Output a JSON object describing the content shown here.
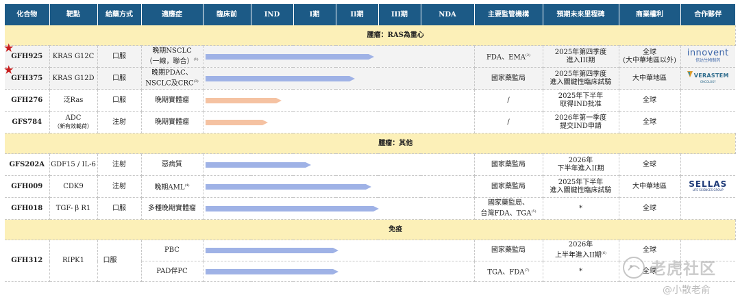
{
  "headers": {
    "compound": "化合物",
    "target": "靶點",
    "route": "給藥方式",
    "indication": "適應症",
    "preclinical": "臨床前",
    "ind": "IND",
    "phase1": "I期",
    "phase2": "II期",
    "phase3": "III期",
    "nda": "NDA",
    "regulator": "主要監管機構",
    "milestone": "預期未來里程碑",
    "rights": "商業權利",
    "partner": "合作夥伴"
  },
  "sections": [
    {
      "title": "腫瘤：RAS為重心"
    },
    {
      "title": "腫瘤：其他"
    },
    {
      "title": "免疫"
    }
  ],
  "rows": [
    {
      "compound": "GFH925",
      "starred": true,
      "target": "KRAS G12C",
      "route": "口服",
      "indication_l1": "晚期NSCLC",
      "indication_l2": "（一線，聯合）",
      "indication_note": "(1)",
      "progress": 0.62,
      "bar_color": "blue",
      "regulator": "FDA、EMA",
      "regulator_note": "(2)",
      "milestone_l1": "2025年第四季度",
      "milestone_l2": "進入III期",
      "rights_l1": "全球",
      "rights_l2": "(大中華地區以外)",
      "partner": "innovent"
    },
    {
      "compound": "GFH375",
      "starred": true,
      "target": "KRAS G12D",
      "route": "口服",
      "indication_l1": "晚期PDAC、",
      "indication_l2": "NSCLC及CRC",
      "indication_note": "(3)",
      "progress": 0.55,
      "bar_color": "blue",
      "regulator": "國家藥監局",
      "regulator_note": "",
      "milestone_l1": "2025年第四季度",
      "milestone_l2": "進入關鍵性臨床試驗",
      "rights_l1": "大中華地區",
      "rights_l2": "",
      "partner": "verastem"
    },
    {
      "compound": "GFH276",
      "starred": false,
      "target": "泛Ras",
      "route": "口服",
      "indication_l1": "晚期實體瘤",
      "indication_l2": "",
      "indication_note": "",
      "progress": 0.28,
      "bar_color": "orange",
      "regulator": "/",
      "regulator_note": "",
      "milestone_l1": "2025年下半年",
      "milestone_l2": "取得IND批准",
      "rights_l1": "全球",
      "rights_l2": "",
      "partner": ""
    },
    {
      "compound": "GFS784",
      "starred": false,
      "target": "ADC",
      "target_l2": "（新有效載荷）",
      "route": "注射",
      "indication_l1": "晚期實體瘤",
      "indication_l2": "",
      "indication_note": "",
      "progress": 0.23,
      "bar_color": "orange",
      "regulator": "/",
      "regulator_note": "",
      "milestone_l1": "2026年第一季度",
      "milestone_l2": "提交IND申請",
      "rights_l1": "全球",
      "rights_l2": "",
      "partner": ""
    },
    {
      "compound": "GFS202A",
      "starred": false,
      "target": "GDF15 / IL-6",
      "route": "注射",
      "indication_l1": "惡病質",
      "indication_l2": "",
      "indication_note": "",
      "progress": 0.39,
      "bar_color": "blue",
      "regulator": "國家藥監局",
      "regulator_note": "",
      "milestone_l1": "2026年",
      "milestone_l2": "下半年進入II期",
      "rights_l1": "全球",
      "rights_l2": "",
      "partner": ""
    },
    {
      "compound": "GFH009",
      "starred": false,
      "target": "CDK9",
      "route": "注射",
      "indication_l1": "晚期AML",
      "indication_l2": "",
      "indication_note": "(4)",
      "progress": 0.61,
      "bar_color": "blue",
      "regulator": "國家藥監局",
      "regulator_note": "",
      "milestone_l1": "2025年下半年",
      "milestone_l2": "進入關鍵性臨床試驗",
      "rights_l1": "大中華地區",
      "rights_l2": "",
      "partner": "sellas"
    },
    {
      "compound": "GFH018",
      "starred": false,
      "target": "TGF- β R1",
      "route": "口服",
      "indication_l1": "多種晚期實體瘤",
      "indication_l2": "",
      "indication_note": "",
      "progress": 0.64,
      "bar_color": "blue",
      "regulator": "國家藥監局、",
      "regulator_l2": "台灣FDA、TGA",
      "regulator_note": "(5)",
      "milestone_l1": "*",
      "milestone_l2": "",
      "rights_l1": "全球",
      "rights_l2": "",
      "partner": ""
    }
  ],
  "immune": {
    "compound": "GFH312",
    "target": "RIPK1",
    "route": "口服",
    "sub": [
      {
        "indication": "PBC",
        "progress": 0.49,
        "regulator": "國家藥監局",
        "regulator_note": "",
        "milestone_l1": "2026年",
        "milestone_l2": "上半年進入II期",
        "milestone_note": "(6)",
        "rights": "全球"
      },
      {
        "indication": "PAD伴PC",
        "progress": 0.49,
        "regulator": "TGA、FDA",
        "regulator_note": "(7)",
        "milestone_l1": "*",
        "milestone_l2": "",
        "milestone_note": "",
        "rights": "全球"
      }
    ]
  },
  "partners": {
    "innovent": {
      "name": "innovent",
      "cn": "信达生物制药"
    },
    "verastem": {
      "name": "VERASTEM",
      "sub": "ONCOLOGY"
    },
    "sellas": {
      "name": "SELLAS",
      "sub": "LIFE SCIENCES GROUP"
    }
  },
  "watermark": {
    "main": "老虎社区",
    "sub": "@小散老俞"
  },
  "colors": {
    "header": "#1c5a86",
    "section": "#fcf0b8",
    "bar_blue": "#9fb2e6",
    "bar_orange": "#f5c2a2",
    "star": "#c81e1e"
  }
}
